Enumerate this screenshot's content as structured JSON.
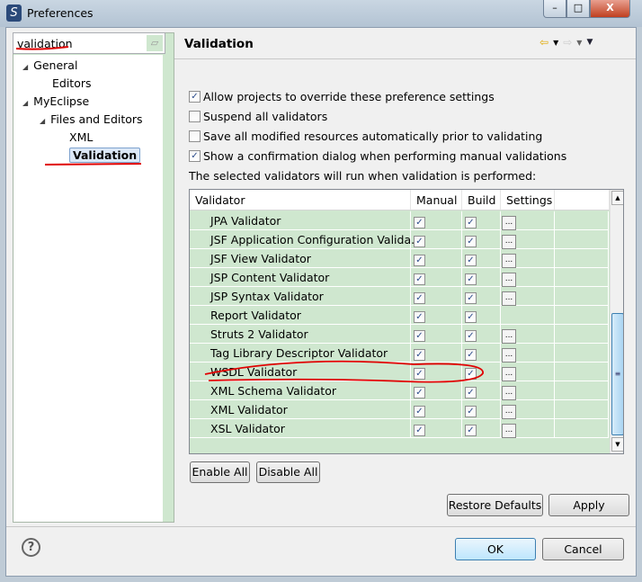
{
  "window": {
    "title": "Preferences",
    "minimize": "–",
    "maximize": "□",
    "close": "X"
  },
  "sidebar": {
    "search_value": "validation",
    "tree": [
      {
        "label": "General",
        "level": 0,
        "expanded": true
      },
      {
        "label": "Editors",
        "level": 1
      },
      {
        "label": "MyEclipse",
        "level": 0,
        "expanded": true
      },
      {
        "label": "Files and Editors",
        "level": 1,
        "expanded": true
      },
      {
        "label": "XML",
        "level": 2
      },
      {
        "label": "Validation",
        "level": 2,
        "selected": true
      }
    ]
  },
  "page": {
    "title": "Validation",
    "options": [
      {
        "label": "Allow projects to override these preference settings",
        "checked": true
      },
      {
        "label": "Suspend all validators",
        "checked": false
      },
      {
        "label": "Save all modified resources automatically prior to validating",
        "checked": false
      },
      {
        "label": "Show a confirmation dialog when performing manual validations",
        "checked": true
      }
    ],
    "info": "The selected validators will run when validation is performed:",
    "table": {
      "columns": [
        "Validator",
        "Manual",
        "Build",
        "Settings"
      ],
      "rows": [
        {
          "name": "JPA Validator",
          "manual": true,
          "build": true,
          "settings": true
        },
        {
          "name": "JSF Application Configuration Valida...",
          "manual": true,
          "build": true,
          "settings": true
        },
        {
          "name": "JSF View Validator",
          "manual": true,
          "build": true,
          "settings": true
        },
        {
          "name": "JSP Content Validator",
          "manual": true,
          "build": true,
          "settings": true
        },
        {
          "name": "JSP Syntax Validator",
          "manual": true,
          "build": true,
          "settings": true
        },
        {
          "name": "Report Validator",
          "manual": true,
          "build": true,
          "settings": false
        },
        {
          "name": "Struts 2 Validator",
          "manual": true,
          "build": true,
          "settings": true
        },
        {
          "name": "Tag Library Descriptor Validator",
          "manual": true,
          "build": true,
          "settings": true
        },
        {
          "name": "WSDL Validator",
          "manual": true,
          "build": true,
          "settings": true
        },
        {
          "name": "XML Schema Validator",
          "manual": true,
          "build": true,
          "settings": true
        },
        {
          "name": "XML Validator",
          "manual": true,
          "build": true,
          "settings": true
        },
        {
          "name": "XSL Validator",
          "manual": true,
          "build": true,
          "settings": true
        }
      ],
      "settings_label": "..."
    },
    "enable_all": "Enable All",
    "disable_all": "Disable All",
    "restore_defaults": "Restore Defaults",
    "apply": "Apply"
  },
  "footer": {
    "help": "?",
    "ok": "OK",
    "cancel": "Cancel"
  },
  "annotation_color": "#e00000"
}
